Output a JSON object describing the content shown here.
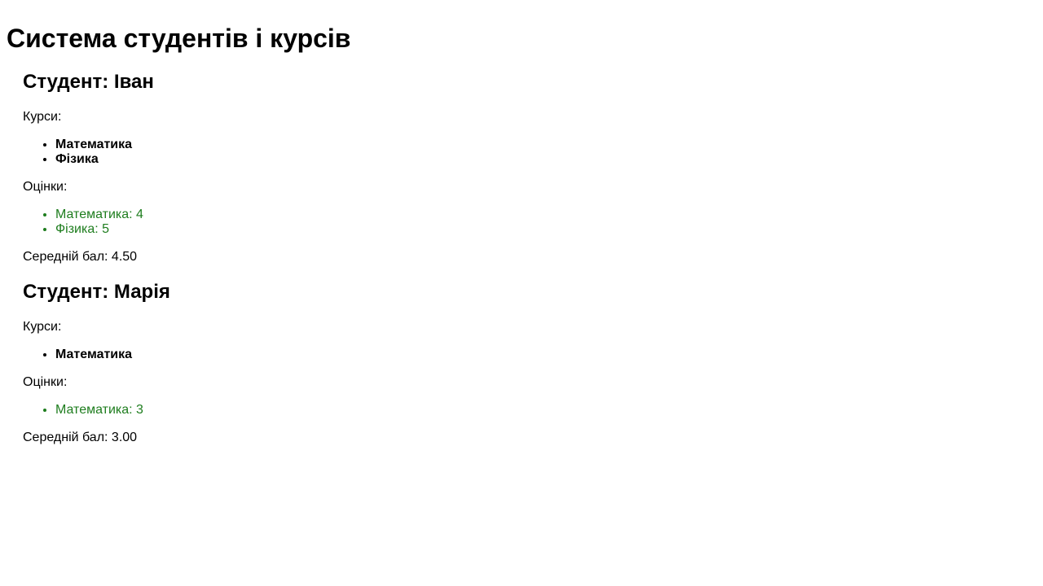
{
  "page": {
    "title": "Система студентів і курсів"
  },
  "labels": {
    "courses": "Курси:",
    "grades": "Оцінки:"
  },
  "colors": {
    "grade_text": "#1e7d1e"
  },
  "students": [
    {
      "heading": "Студент: Іван",
      "courses": [
        "Математика",
        "Фізика"
      ],
      "grades": [
        "Математика: 4",
        "Фізика: 5"
      ],
      "average": "Середній бал: 4.50"
    },
    {
      "heading": "Студент: Марія",
      "courses": [
        "Математика"
      ],
      "grades": [
        "Математика: 3"
      ],
      "average": "Середній бал: 3.00"
    }
  ]
}
